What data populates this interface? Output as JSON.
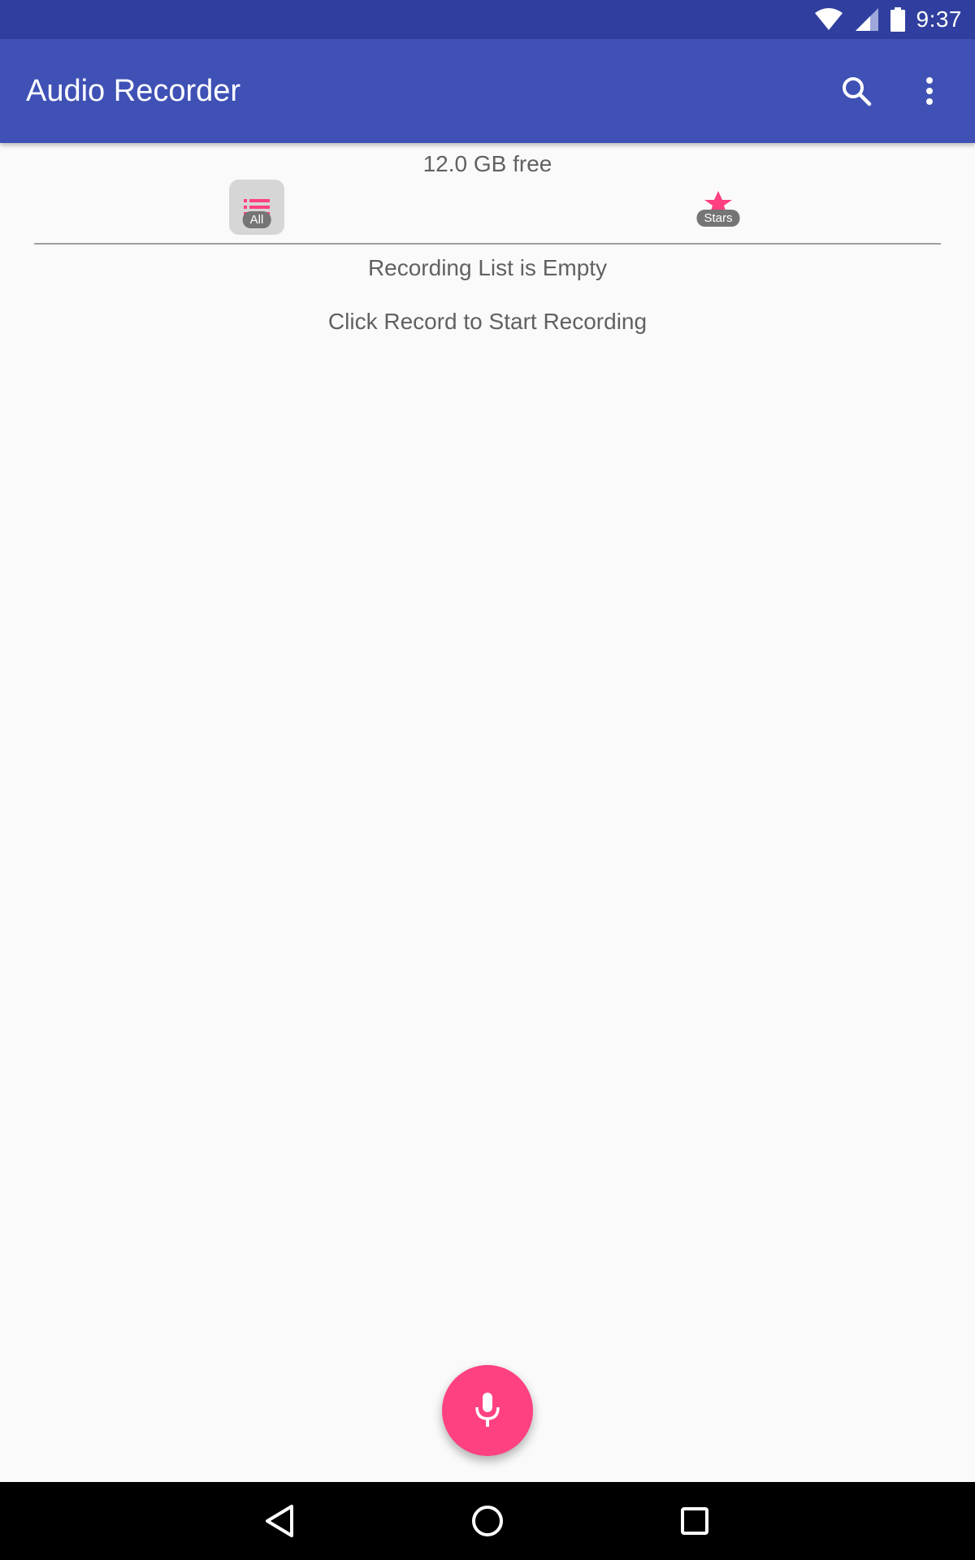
{
  "status_bar": {
    "time": "9:37",
    "icons": [
      "wifi-icon",
      "cellular-signal-icon",
      "battery-icon"
    ]
  },
  "app_bar": {
    "title": "Audio Recorder",
    "actions": [
      "search-icon",
      "more-vert-icon"
    ],
    "background": "#3f51b5"
  },
  "storage": {
    "free_label": "12.0 GB free"
  },
  "tabs": [
    {
      "label": "All",
      "icon": "list-icon",
      "selected": true
    },
    {
      "label": "Stars",
      "icon": "star-icon",
      "selected": false
    }
  ],
  "empty_state": {
    "title": "Recording List is Empty",
    "hint": "Click Record to Start Recording"
  },
  "fab": {
    "icon": "microphone-icon",
    "color": "#ff4081"
  },
  "nav_bar": {
    "buttons": [
      "back-icon",
      "home-icon",
      "recents-icon"
    ]
  },
  "colors": {
    "status_bar": "#303f9f",
    "accent": "#ff4081",
    "text_secondary": "#616161"
  }
}
